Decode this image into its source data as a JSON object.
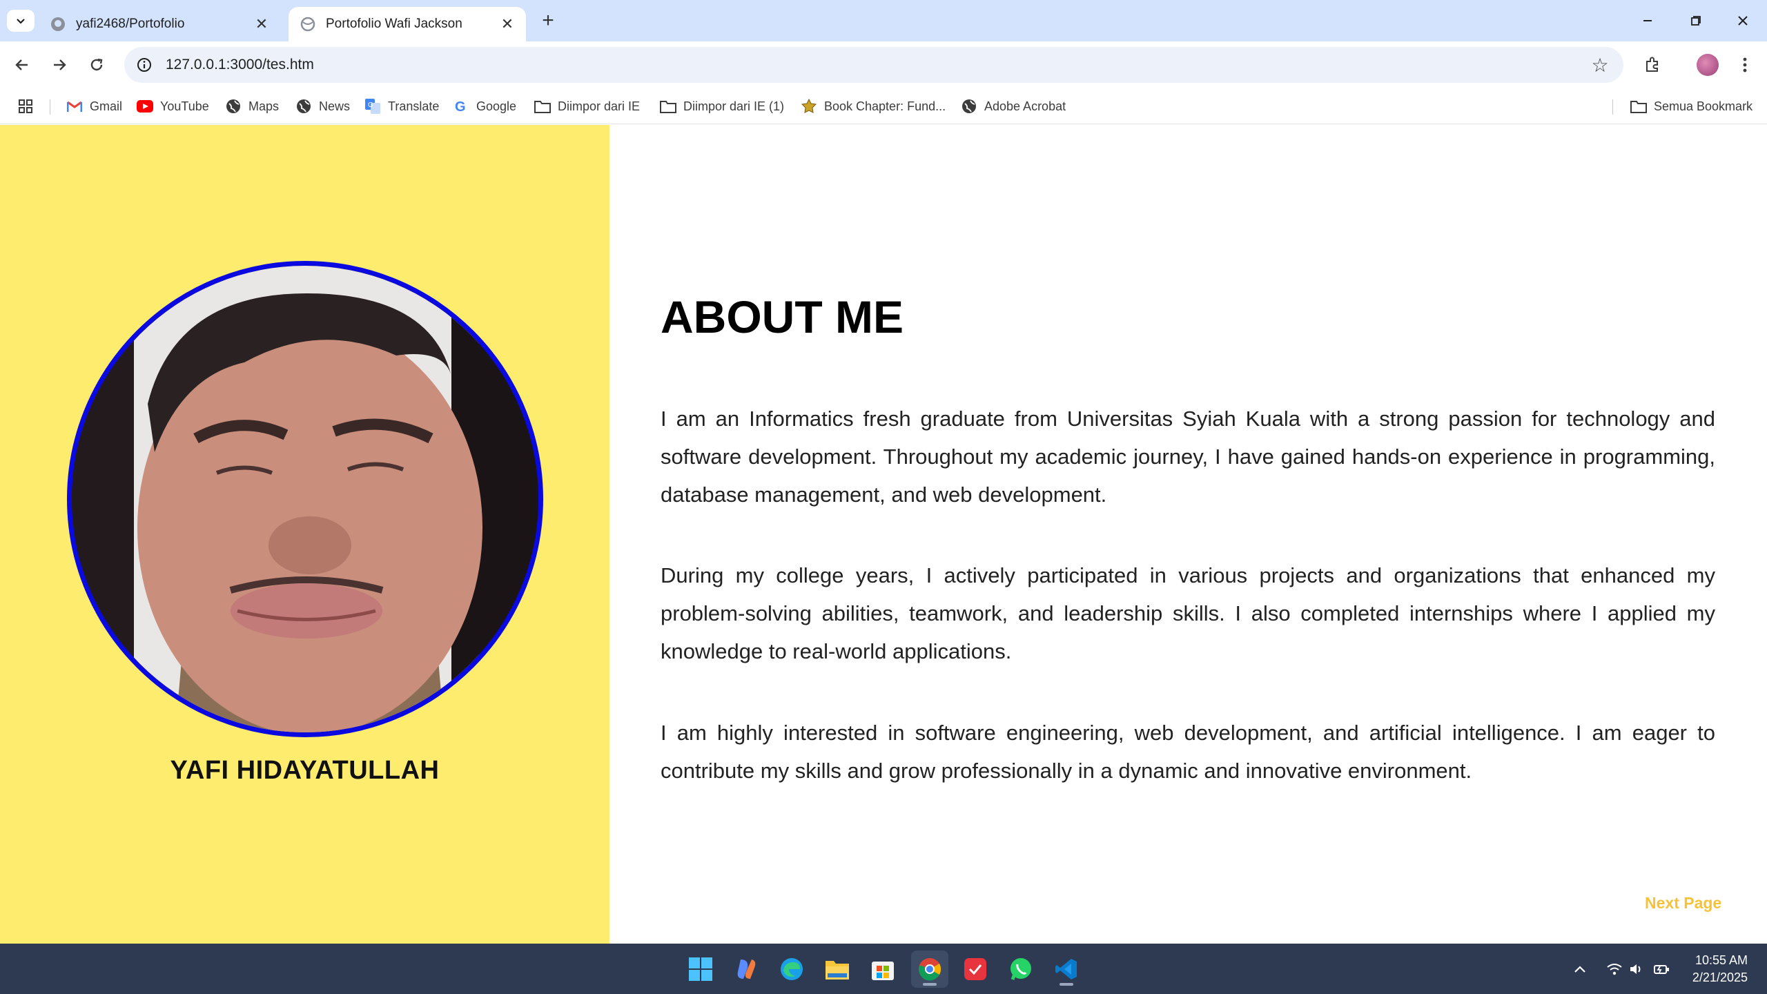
{
  "browser": {
    "tabs": [
      {
        "title": "yafi2468/Portofolio",
        "icon": "github-icon",
        "active": false
      },
      {
        "title": "Portofolio Wafi Jackson",
        "icon": "globe-icon",
        "active": true
      }
    ],
    "url": "127.0.0.1:3000/tes.htm",
    "bookmarks": [
      {
        "label": "Gmail",
        "icon": "gmail-icon"
      },
      {
        "label": "YouTube",
        "icon": "youtube-icon"
      },
      {
        "label": "Maps",
        "icon": "globe-icon"
      },
      {
        "label": "News",
        "icon": "globe-icon"
      },
      {
        "label": "Translate",
        "icon": "translate-icon"
      },
      {
        "label": "Google",
        "icon": "google-icon"
      },
      {
        "label": "Diimpor dari IE",
        "icon": "folder-icon"
      },
      {
        "label": "Diimpor dari IE (1)",
        "icon": "folder-icon"
      },
      {
        "label": "Book Chapter: Fund...",
        "icon": "badge-icon"
      },
      {
        "label": "Adobe Acrobat",
        "icon": "globe-icon"
      }
    ],
    "all_bookmarks_label": "Semua Bookmark"
  },
  "profile": {
    "name": "YAFI HIDAYATULLAH"
  },
  "about": {
    "title": "ABOUT ME",
    "paragraphs": [
      "I am an Informatics fresh graduate from Universitas Syiah Kuala with a strong passion for technology and software development. Throughout my academic journey, I have gained hands-on experience in programming, database management, and web development.",
      "During my college years, I actively participated in various projects and organizations that enhanced my problem-solving abilities, teamwork, and leadership skills. I also completed internships where I applied my knowledge to real-world applications.",
      "I am highly interested in software engineering, web development, and artificial intelligence. I am eager to contribute my skills and grow professionally in a dynamic and innovative environment."
    ],
    "next_page_label": "Next Page"
  },
  "taskbar": {
    "apps": [
      "windows-start-icon",
      "copilot-icon",
      "edge-icon",
      "file-explorer-icon",
      "microsoft-store-icon",
      "chrome-icon",
      "calendar-app-icon",
      "whatsapp-icon",
      "vscode-icon"
    ],
    "time": "10:55 AM",
    "date": "2/21/2025"
  },
  "colors": {
    "left_panel_bg": "#fdec6e",
    "photo_border": "#0a0ae0",
    "next_page": "#f5c33b",
    "taskbar_bg": "#2d3a52",
    "tabbar_bg": "#d3e3fd"
  }
}
